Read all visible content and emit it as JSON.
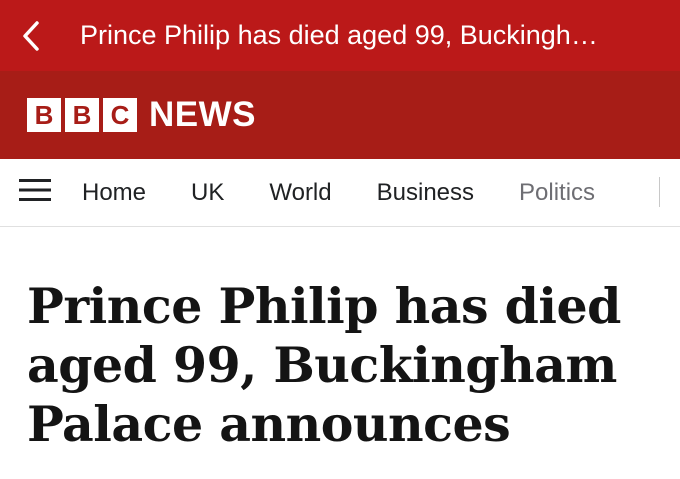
{
  "top_bar": {
    "title": "Prince Philip has died aged 99, Buckingh…",
    "background": "#bb1919",
    "back_icon": "chevron-left-icon"
  },
  "brand": {
    "blocks": [
      "B",
      "B",
      "C"
    ],
    "wordmark": "NEWS",
    "background": "#a71d17"
  },
  "nav": {
    "menu_icon": "hamburger-menu-icon",
    "items": [
      {
        "label": "Home"
      },
      {
        "label": "UK"
      },
      {
        "label": "World"
      },
      {
        "label": "Business"
      },
      {
        "label": "Politics"
      }
    ]
  },
  "article": {
    "headline": "Prince Philip has died aged 99, Buckingham Palace announces"
  }
}
